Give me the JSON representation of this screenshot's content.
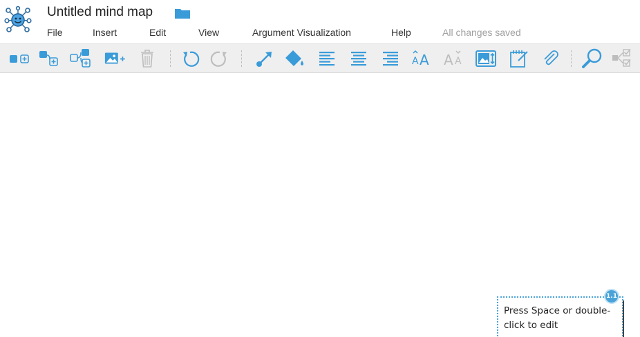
{
  "app": {
    "title": "Untitled mind map",
    "status": "All changes saved",
    "logo_icon": "mindmup-logo-icon",
    "folder_icon": "folder-icon"
  },
  "menu": [
    {
      "label": "File"
    },
    {
      "label": "Insert"
    },
    {
      "label": "Edit"
    },
    {
      "label": "View"
    },
    {
      "label": "Argument Visualization"
    },
    {
      "label": "Help"
    }
  ],
  "toolbar": {
    "icons": [
      "add-child-node-icon",
      "add-sibling-node-icon",
      "add-parent-node-icon",
      "add-image-icon",
      "delete-icon",
      "undo-icon",
      "redo-icon",
      "connect-icon",
      "fill-color-icon",
      "align-left-icon",
      "align-center-icon",
      "align-right-icon",
      "increase-font-icon",
      "decrease-font-icon",
      "image-size-icon",
      "note-icon",
      "attachment-icon",
      "zoom-icon",
      "checklist-icon"
    ],
    "accent_color": "#3a9bd9",
    "disabled_color": "#bdbdbd"
  },
  "canvas": {
    "node": {
      "text": "Press Space or double-click to edit",
      "text_line1": "Press Space or double-",
      "text_line2": "click to edit",
      "badge": "1.1",
      "border_color": "#4aa3d8"
    }
  }
}
